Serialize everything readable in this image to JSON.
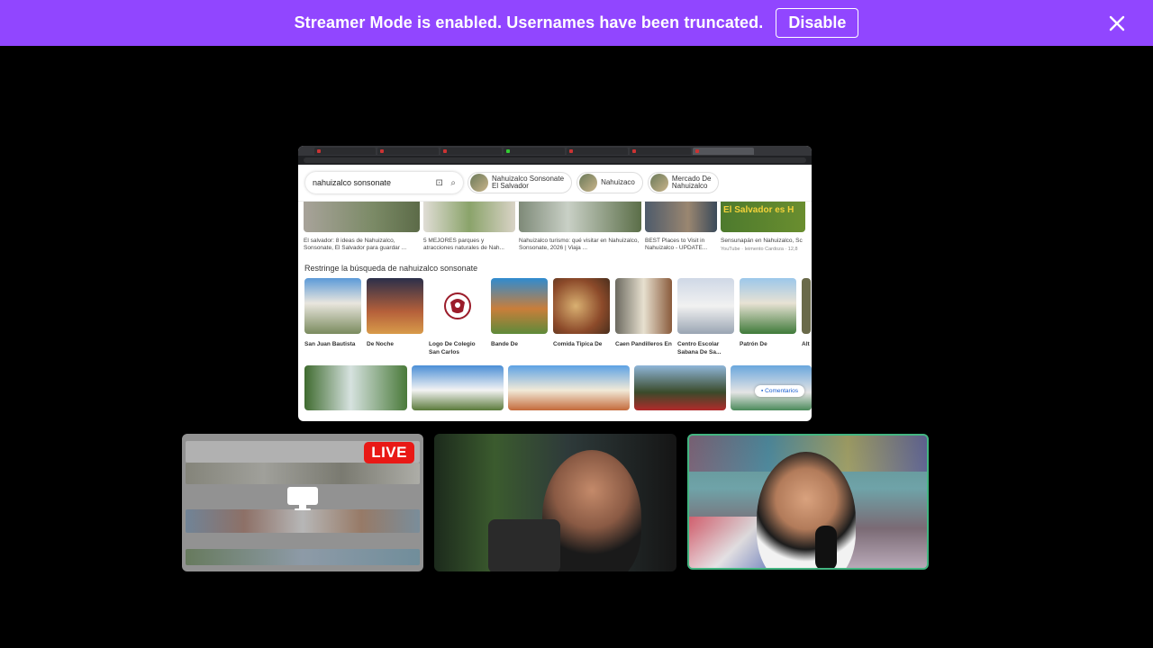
{
  "banner": {
    "message": "Streamer Mode is enabled. Usernames have been truncated.",
    "disable_label": "Disable",
    "color": "#9146ff"
  },
  "screen_share": {
    "search_query": "nahuizalco sonsonate",
    "chips": [
      {
        "line1": "Nahuizalco Sonsonate",
        "line2": "El Salvador"
      },
      {
        "line1": "Nahuizaco",
        "line2": ""
      },
      {
        "line1": "Mercado De",
        "line2": "Nahuizalco"
      }
    ],
    "result_cards": [
      "El salvador: 8 ideas de Nahuizalco, Sonsonate, El Salvador para guardar ...",
      "5 MEJORES parques y atracciones naturales de Nah...",
      "Nahuizalco turismo: qué visitar en Nahuizalco, Sonsonate, 2026 | Viaja ...",
      "BEST Places to Visit in Nahuizalco - UPDATE...",
      "Sensunapán en Nahuizalco, Sc"
    ],
    "result_card_source": "YouTube · Ieimento Cardoza · 12,8",
    "restrict_heading": "Restringe la búsqueda de nahuizalco sonsonate",
    "related": [
      "San Juan Bautista",
      "De Noche",
      "Logo De Colegio San Carlos",
      "Bande De",
      "Comida Tipica De",
      "Caen Pandilleros En",
      "Centro Escolar Sabana De Sa...",
      "Patrón De",
      "Alt"
    ],
    "feedback_label": "Comentarios",
    "banner_overlay_text": "El Salvador es H"
  },
  "live_badge": "LIVE",
  "accent_colors": {
    "live": "#e91916",
    "speaking": "#43b581"
  }
}
